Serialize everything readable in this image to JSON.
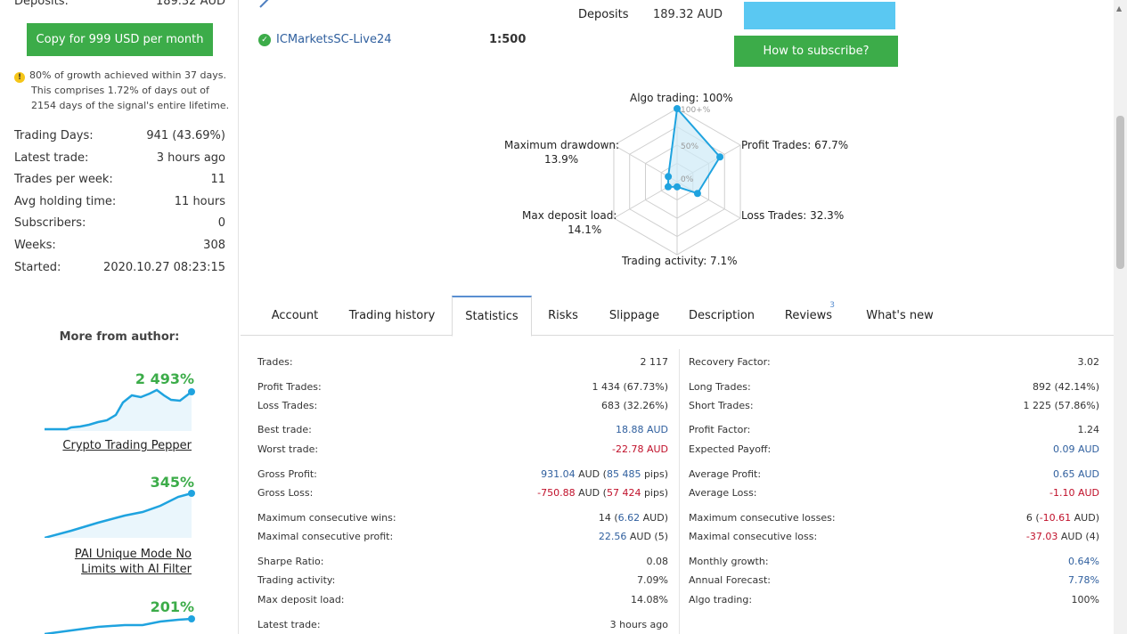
{
  "left": {
    "deposits_label": "Deposits:",
    "deposits_value": "189.32 AUD",
    "copy_button": "Copy for 999 USD per month",
    "growth_note_line1": "80% of growth achieved within 37 days.",
    "growth_note_rest": "This comprises 1.72% of days out of 2154 days of the signal's entire lifetime.",
    "stats": [
      {
        "label": "Trading Days:",
        "value": "941 (43.69%)"
      },
      {
        "label": "Latest trade:",
        "value": "3 hours ago"
      },
      {
        "label": "Trades per week:",
        "value": "11"
      },
      {
        "label": "Avg holding time:",
        "value": "11 hours"
      },
      {
        "label": "Subscribers:",
        "value": "0"
      },
      {
        "label": "Weeks:",
        "value": "308"
      },
      {
        "label": "Started:",
        "value": "2020.10.27 08:23:15"
      }
    ],
    "more_from_author": "More from author:",
    "author_items": [
      {
        "pct": "2 493%",
        "name": "Crypto Trading Pepper"
      },
      {
        "pct": "345%",
        "name": "PAI Unique Mode No Limits with AI Filter"
      },
      {
        "pct": "201%",
        "name": ""
      }
    ]
  },
  "header": {
    "deposits_label": "Deposits",
    "deposits_value": "189.32 AUD",
    "server": "ICMarketsSC-Live24",
    "leverage": "1:500",
    "how_to_subscribe": "How to subscribe?"
  },
  "radar": {
    "algo": "Algo trading: 100%",
    "profit": "Profit Trades: 67.7%",
    "loss": "Loss Trades: 32.3%",
    "activity": "Trading activity: 7.1%",
    "deposit_load_1": "Max deposit load:",
    "deposit_load_2": "14.1%",
    "drawdown_1": "Maximum drawdown:",
    "drawdown_2": "13.9%",
    "scale_100": "100+%",
    "scale_50": "50%",
    "scale_0": "0%",
    "values_pct": {
      "algo": 100,
      "profit": 67.7,
      "loss": 32.3,
      "activity": 7.1,
      "deposit_load": 14.1,
      "drawdown": 13.9
    },
    "colors": {
      "line": "#1fa3df",
      "fill": "#cdeaf7",
      "grid": "#cfcfcf"
    }
  },
  "tabs": [
    {
      "label": "Account"
    },
    {
      "label": "Trading history"
    },
    {
      "label": "Statistics"
    },
    {
      "label": "Risks"
    },
    {
      "label": "Slippage"
    },
    {
      "label": "Description"
    },
    {
      "label": "Reviews",
      "badge": "3"
    },
    {
      "label": "What's new"
    }
  ],
  "stats_left": [
    {
      "label": "Trades:",
      "value": "2 117"
    },
    {
      "label": "Profit Trades:",
      "value": "1 434 (67.73%)"
    },
    {
      "label": "Loss Trades:",
      "value": "683 (32.26%)"
    },
    {
      "label": "Best trade:",
      "value": "18.88 AUD"
    },
    {
      "label": "Worst trade:",
      "value": "-22.78 AUD"
    },
    {
      "label": "Gross Profit:",
      "value_a": "931.04",
      "value_b": " AUD (",
      "value_c": "85 485",
      "value_d": " pips)"
    },
    {
      "label": "Gross Loss:",
      "value_a": "-750.88",
      "value_b": " AUD (",
      "value_c": "57 424",
      "value_d": " pips)"
    },
    {
      "label": "Maximum consecutive wins:",
      "value_a": "14 (",
      "value_b": "6.62",
      "value_c": " AUD)"
    },
    {
      "label": "Maximal consecutive profit:",
      "value_a": "22.56",
      "value_b": " AUD (5)"
    },
    {
      "label": "Sharpe Ratio:",
      "value": "0.08"
    },
    {
      "label": "Trading activity:",
      "value": "7.09%"
    },
    {
      "label": "Max deposit load:",
      "value": "14.08%"
    },
    {
      "label": "Latest trade:",
      "value": "3 hours ago"
    }
  ],
  "stats_right": [
    {
      "label": "Recovery Factor:",
      "value": "3.02"
    },
    {
      "label": "Long Trades:",
      "value": "892 (42.14%)"
    },
    {
      "label": "Short Trades:",
      "value": "1 225 (57.86%)"
    },
    {
      "label": "Profit Factor:",
      "value": "1.24"
    },
    {
      "label": "Expected Payoff:",
      "value": "0.09 AUD"
    },
    {
      "label": "Average Profit:",
      "value": "0.65 AUD"
    },
    {
      "label": "Average Loss:",
      "value": "-1.10 AUD"
    },
    {
      "label": "Maximum consecutive losses:",
      "value_a": "6 (",
      "value_b": "-10.61",
      "value_c": " AUD)"
    },
    {
      "label": "Maximal consecutive loss:",
      "value_a": "-37.03",
      "value_b": " AUD (4)"
    },
    {
      "label": "Monthly growth:",
      "value": "0.64%"
    },
    {
      "label": "Annual Forecast:",
      "value": "7.78%"
    },
    {
      "label": "Algo trading:",
      "value": "100%"
    }
  ]
}
